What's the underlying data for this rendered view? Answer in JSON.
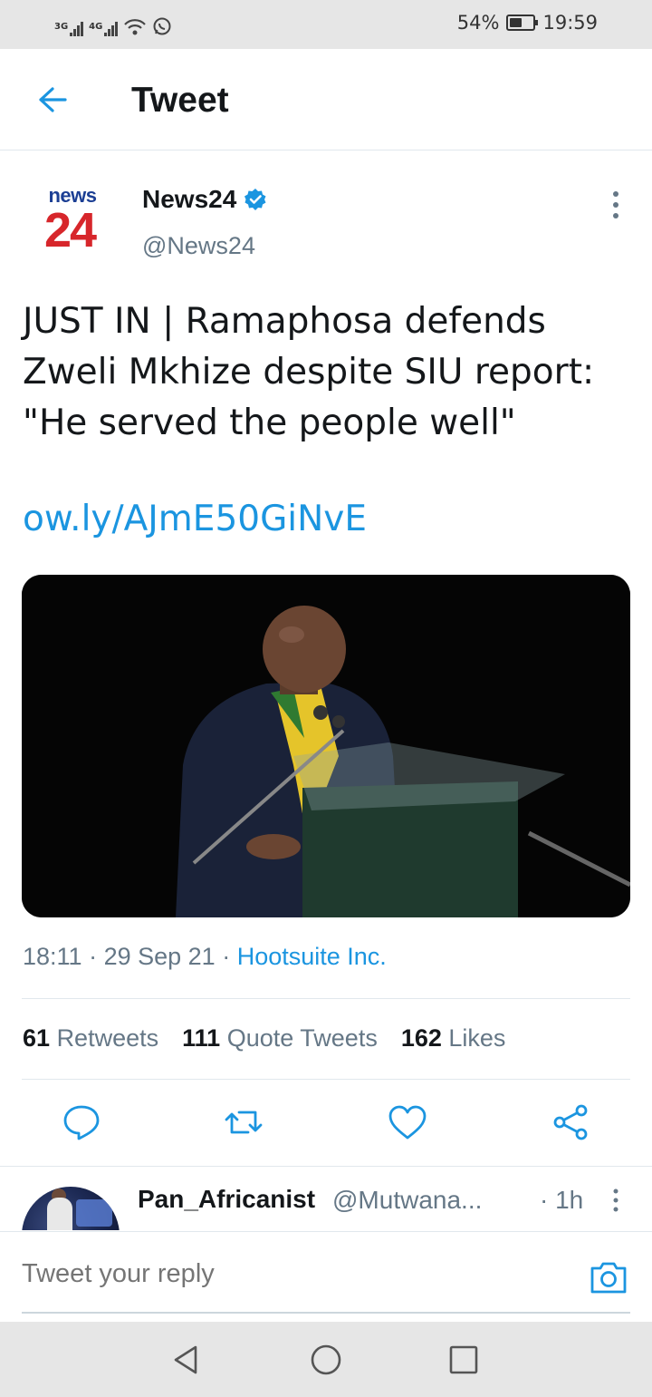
{
  "status_bar": {
    "network1": "3G",
    "network2": "4G",
    "battery_percent": "54%",
    "battery_level": 0.54,
    "time": "19:59"
  },
  "header": {
    "title": "Tweet",
    "back_icon": "arrow-left-icon"
  },
  "tweet": {
    "logo_line1": "news",
    "logo_line2": "24",
    "author_name": "News24",
    "verified": true,
    "handle": "@News24",
    "text": "JUST IN | Ramaphosa defends Zweli Mkhize despite SIU report: \"He served the people well\"",
    "link": "ow.ly/AJmE50GiNvE",
    "time": "18:11",
    "date": "29 Sep 21",
    "source": "Hootsuite Inc.",
    "retweets_count": "61",
    "retweets_label": "Retweets",
    "quotes_count": "111",
    "quotes_label": "Quote Tweets",
    "likes_count": "162",
    "likes_label": "Likes",
    "accent_color": "#1b95e0"
  },
  "reply_preview": {
    "name": "Pan_Africanist",
    "handle": "@Mutwana...",
    "time": "· 1h"
  },
  "compose": {
    "placeholder": "Tweet your reply"
  },
  "nav": {
    "icons": [
      "back-triangle-icon",
      "home-circle-icon",
      "recents-square-icon"
    ]
  }
}
